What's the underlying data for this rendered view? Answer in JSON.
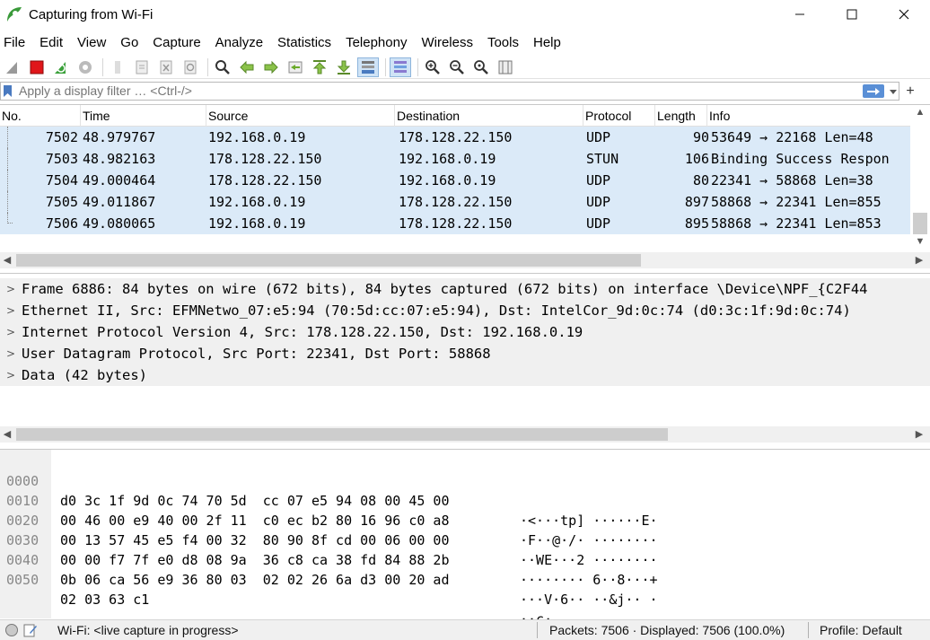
{
  "window": {
    "title": "Capturing from Wi-Fi"
  },
  "menu": [
    "File",
    "Edit",
    "View",
    "Go",
    "Capture",
    "Analyze",
    "Statistics",
    "Telephony",
    "Wireless",
    "Tools",
    "Help"
  ],
  "filter": {
    "placeholder": "Apply a display filter … <Ctrl-/>"
  },
  "packet_list": {
    "columns": [
      "No.",
      "Time",
      "Source",
      "Destination",
      "Protocol",
      "Length",
      "Info"
    ],
    "rows": [
      {
        "no": "7502",
        "time": "48.979767",
        "src": "192.168.0.19",
        "dst": "178.128.22.150",
        "proto": "UDP",
        "len": "90",
        "info": "53649 → 22168 Len=48"
      },
      {
        "no": "7503",
        "time": "48.982163",
        "src": "178.128.22.150",
        "dst": "192.168.0.19",
        "proto": "STUN",
        "len": "106",
        "info": "Binding Success Respon"
      },
      {
        "no": "7504",
        "time": "49.000464",
        "src": "178.128.22.150",
        "dst": "192.168.0.19",
        "proto": "UDP",
        "len": "80",
        "info": "22341 → 58868 Len=38"
      },
      {
        "no": "7505",
        "time": "49.011867",
        "src": "192.168.0.19",
        "dst": "178.128.22.150",
        "proto": "UDP",
        "len": "897",
        "info": "58868 → 22341 Len=855"
      },
      {
        "no": "7506",
        "time": "49.080065",
        "src": "192.168.0.19",
        "dst": "178.128.22.150",
        "proto": "UDP",
        "len": "895",
        "info": "58868 → 22341 Len=853"
      }
    ],
    "row_color": "#dbeaf8"
  },
  "details": [
    "Frame 6886: 84 bytes on wire (672 bits), 84 bytes captured (672 bits) on interface \\Device\\NPF_{C2F44",
    "Ethernet II, Src: EFMNetwo_07:e5:94 (70:5d:cc:07:e5:94), Dst: IntelCor_9d:0c:74 (d0:3c:1f:9d:0c:74)",
    "Internet Protocol Version 4, Src: 178.128.22.150, Dst: 192.168.0.19",
    "User Datagram Protocol, Src Port: 22341, Dst Port: 58868",
    "Data (42 bytes)"
  ],
  "bytes": [
    {
      "offset": "0000",
      "hex": "d0 3c 1f 9d 0c 74 70 5d  cc 07 e5 94 08 00 45 00",
      "ascii": "·<···tp] ······E·"
    },
    {
      "offset": "0010",
      "hex": "00 46 00 e9 40 00 2f 11  c0 ec b2 80 16 96 c0 a8",
      "ascii": "·F··@·/· ········"
    },
    {
      "offset": "0020",
      "hex": "00 13 57 45 e5 f4 00 32  80 90 8f cd 00 06 00 00",
      "ascii": "··WE···2 ········"
    },
    {
      "offset": "0030",
      "hex": "00 00 f7 7f e0 d8 08 9a  36 c8 ca 38 fd 84 88 2b",
      "ascii": "········ 6··8···+"
    },
    {
      "offset": "0040",
      "hex": "0b 06 ca 56 e9 36 80 03  02 02 26 6a d3 00 20 ad",
      "ascii": "···V·6·· ··&j·· ·"
    },
    {
      "offset": "0050",
      "hex": "02 03 63 c1",
      "ascii": "··c·"
    }
  ],
  "status": {
    "capture_text": "Wi-Fi: <live capture in progress>",
    "packets_text": "Packets: 7506 · Displayed: 7506 (100.0%)",
    "profile_text": "Profile: Default"
  }
}
